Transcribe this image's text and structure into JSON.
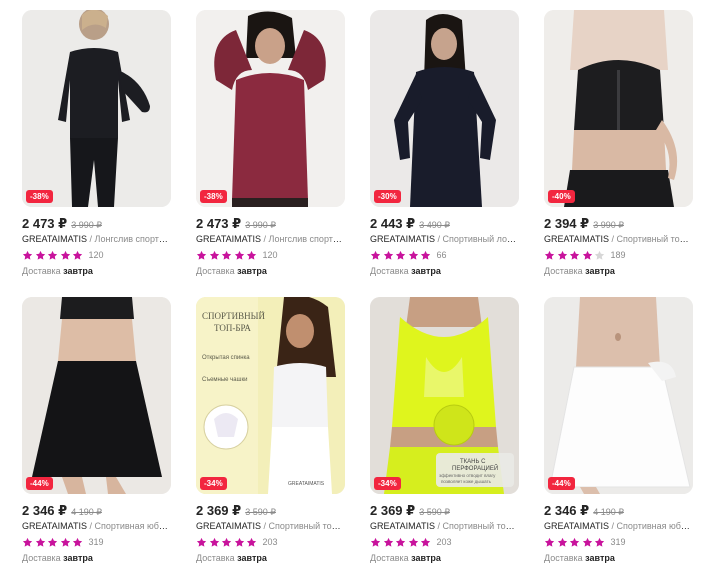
{
  "colors": {
    "accent_badge": "#f2263f",
    "star_filled": "#c8139c",
    "star_empty": "#d7d7d7"
  },
  "delivery_prefix": "Доставка",
  "products": [
    {
      "discount": "-38%",
      "price": "2 473 ₽",
      "old_price": "3 990 ₽",
      "brand": "GREATAIMATIS",
      "title": "/ Лонгслив спортивный",
      "stars": 5,
      "reviews": "120",
      "delivery": "завтра"
    },
    {
      "discount": "-38%",
      "price": "2 473 ₽",
      "old_price": "3 990 ₽",
      "brand": "GREATAIMATIS",
      "title": "/ Лонгслив спортивный",
      "stars": 5,
      "reviews": "120",
      "delivery": "завтра"
    },
    {
      "discount": "-30%",
      "price": "2 443 ₽",
      "old_price": "3 490 ₽",
      "brand": "GREATAIMATIS",
      "title": "/ Спортивный лонгслив",
      "stars": 5,
      "reviews": "66",
      "delivery": "завтра"
    },
    {
      "discount": "-40%",
      "price": "2 394 ₽",
      "old_price": "3 990 ₽",
      "brand": "GREATAIMATIS",
      "title": "/ Спортивный топ-бра",
      "stars": 4,
      "reviews": "189",
      "delivery": "завтра"
    },
    {
      "discount": "-44%",
      "price": "2 346 ₽",
      "old_price": "4 190 ₽",
      "brand": "GREATAIMATIS",
      "title": "/ Спортивная юбка-шорты",
      "stars": 5,
      "reviews": "319",
      "delivery": "завтра"
    },
    {
      "discount": "-34%",
      "price": "2 369 ₽",
      "old_price": "3 590 ₽",
      "brand": "GREATAIMATIS",
      "title": "/ Спортивный топ бра",
      "stars": 5,
      "reviews": "203",
      "delivery": "завтра",
      "promo": {
        "heading_1": "СПОРТИВНЫЙ",
        "heading_2": "ТОП-БРА",
        "feature_1": "Открытая спинка",
        "feature_2": "Съемные чашки",
        "brand_tag": "GREATAIMATIS"
      }
    },
    {
      "discount": "-34%",
      "price": "2 369 ₽",
      "old_price": "3 590 ₽",
      "brand": "GREATAIMATIS",
      "title": "/ Спортивный топ бра",
      "stars": 5,
      "reviews": "203",
      "delivery": "завтра",
      "promo": {
        "tag_1": "ТКАНЬ С",
        "tag_2": "ПЕРФОРАЦИЕЙ",
        "tag_3": "эффективно отводит влагу",
        "tag_4": "позволяет коже дышать"
      }
    },
    {
      "discount": "-44%",
      "price": "2 346 ₽",
      "old_price": "4 190 ₽",
      "brand": "GREATAIMATIS",
      "title": "/ Спортивная юбка-шорты",
      "stars": 5,
      "reviews": "319",
      "delivery": "завтра"
    }
  ]
}
